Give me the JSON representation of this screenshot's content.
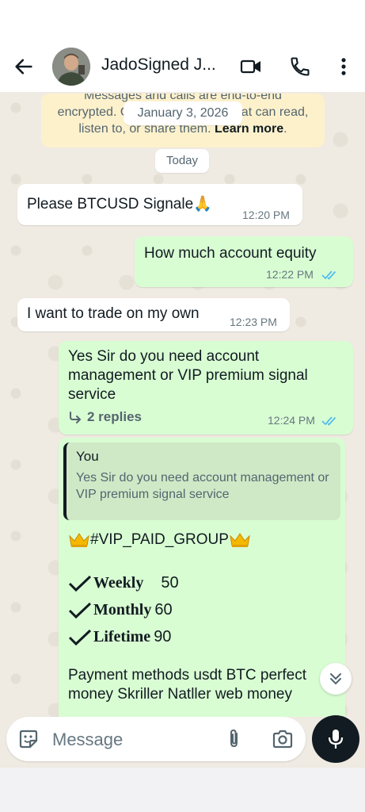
{
  "header": {
    "contact_name": "JadoSigned J...",
    "icons": [
      "back-arrow-icon",
      "video-call-icon",
      "phone-icon",
      "more-vert-icon"
    ]
  },
  "notices": {
    "encryption_line1": "Messages and calls are end-to-end",
    "encryption_line2": "encrypted. Only people in this chat can read,",
    "encryption_line3_prefix": "listen to, or share them. ",
    "encryption_link": "Learn more",
    "encryption_suffix": ".",
    "date_chip": "January 3, 2026",
    "today_chip": "Today"
  },
  "messages": [
    {
      "direction": "in",
      "text": "Please BTCUSD Signale🙏",
      "time": "12:20 PM"
    },
    {
      "direction": "out",
      "text": "How much account equity",
      "time": "12:22 PM",
      "status": "read"
    },
    {
      "direction": "in",
      "text": "I want to trade on my own",
      "time": "12:23 PM"
    },
    {
      "direction": "out",
      "text": "Yes Sir do you need account management or VIP premium signal service",
      "time": "12:24 PM",
      "status": "read",
      "replies": "2 replies"
    }
  ],
  "reply_message": {
    "quote_author": "You",
    "quote_text": "Yes Sir do you need account management or VIP premium signal service",
    "group_tag": "#VIP_PAID_GROUP",
    "plans": [
      {
        "name": "Weekly",
        "price": "50"
      },
      {
        "name": "Monthly",
        "price": "60"
      },
      {
        "name": "Lifetime",
        "price": "90"
      }
    ],
    "payment_text": "Payment methods usdt BTC perfect money Skriller Natller web money"
  },
  "composer": {
    "placeholder": "Message",
    "icons": [
      "emoji-sticker-icon",
      "attach-icon",
      "camera-icon",
      "microphone-icon"
    ]
  },
  "colors": {
    "outgoing_bubble": "#d9fdd3",
    "incoming_bubble": "#ffffff",
    "read_ticks": "#53bdeb",
    "chat_background": "#efeae2"
  }
}
